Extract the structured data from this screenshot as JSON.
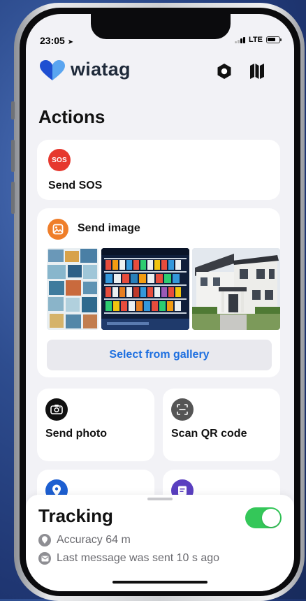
{
  "status_bar": {
    "time": "23:05",
    "network": "LTE"
  },
  "header": {
    "brand": "wiatag",
    "settings_icon": "hexagon-settings-icon",
    "map_icon": "map-icon"
  },
  "actions": {
    "title": "Actions",
    "sos": {
      "badge": "SOS",
      "label": "Send SOS",
      "color": "#e6382e"
    },
    "send_image": {
      "label": "Send image",
      "icon": "image-icon",
      "color": "#ef7e2a",
      "thumbnails": [
        "photo-collage-thumbnail",
        "store-shelves-thumbnail",
        "house-thumbnail"
      ],
      "gallery_button": "Select from gallery"
    },
    "send_photo": {
      "label": "Send photo",
      "icon": "camera-icon"
    },
    "scan_qr": {
      "label": "Scan QR code",
      "icon": "qr-scan-icon"
    },
    "partial_left_icon": "location-pin-icon",
    "partial_right_icon": "message-icon"
  },
  "tracking": {
    "title": "Tracking",
    "enabled": true,
    "accuracy": "Accuracy 64 m",
    "last_message": "Last message was sent 10 s ago",
    "toggle_color": "#34c759"
  },
  "colors": {
    "accent_blue": "#1d6fe0",
    "sos_red": "#e6382e",
    "image_orange": "#ef7e2a",
    "location_blue": "#1d5fd1",
    "message_purple": "#5a3fc0"
  }
}
